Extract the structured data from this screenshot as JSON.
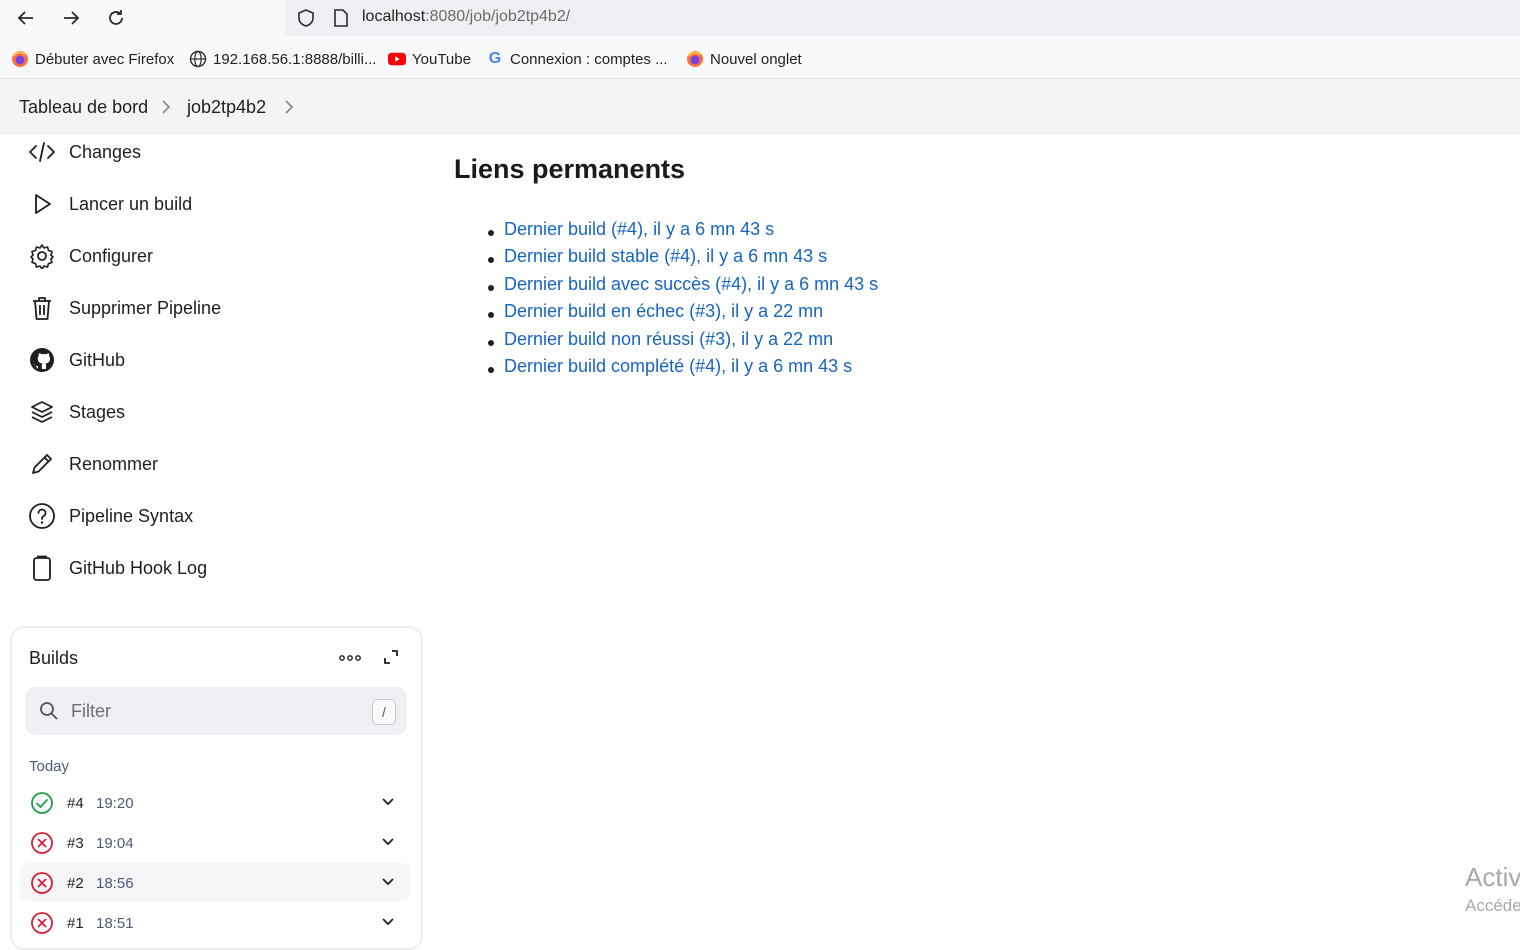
{
  "browser": {
    "url_host": "localhost",
    "url_rest": ":8080/job/job2tp4b2/",
    "bookmarks": [
      {
        "label": "Débuter avec Firefox",
        "icon": "firefox-icon"
      },
      {
        "label": "192.168.56.1:8888/billi...",
        "icon": "globe-icon"
      },
      {
        "label": "YouTube",
        "icon": "youtube-icon"
      },
      {
        "label": "Connexion : comptes ...",
        "icon": "google-icon"
      },
      {
        "label": "Nouvel onglet",
        "icon": "firefox-icon"
      }
    ]
  },
  "breadcrumb": {
    "items": [
      "Tableau de bord",
      "job2tp4b2"
    ]
  },
  "sidebar": {
    "items": [
      {
        "label": "Changes",
        "icon": "code-icon"
      },
      {
        "label": "Lancer un build",
        "icon": "play-icon"
      },
      {
        "label": "Configurer",
        "icon": "gear-icon"
      },
      {
        "label": "Supprimer Pipeline",
        "icon": "trash-icon"
      },
      {
        "label": "GitHub",
        "icon": "github-icon"
      },
      {
        "label": "Stages",
        "icon": "layers-icon"
      },
      {
        "label": "Renommer",
        "icon": "pencil-icon"
      },
      {
        "label": "Pipeline Syntax",
        "icon": "help-icon"
      },
      {
        "label": "GitHub Hook Log",
        "icon": "clipboard-icon"
      }
    ]
  },
  "builds": {
    "title": "Builds",
    "filter_placeholder": "Filter",
    "shortcut": "/",
    "group_label": "Today",
    "rows": [
      {
        "number": "#4",
        "time": "19:20",
        "status": "success"
      },
      {
        "number": "#3",
        "time": "19:04",
        "status": "failed"
      },
      {
        "number": "#2",
        "time": "18:56",
        "status": "failed"
      },
      {
        "number": "#1",
        "time": "18:51",
        "status": "failed"
      }
    ]
  },
  "main": {
    "title": "Liens permanents",
    "links": [
      "Dernier build (#4), il y a 6 mn 43 s",
      "Dernier build stable (#4), il y a 6 mn 43 s",
      "Dernier build avec succès (#4), il y a 6 mn 43 s",
      "Dernier build en échec (#3), il y a 22 mn",
      "Dernier build non réussi (#3), il y a 22 mn",
      "Dernier build complété (#4), il y a 6 mn 43 s"
    ]
  },
  "watermark": {
    "line1": "Activ",
    "line2": "Accéde"
  },
  "colors": {
    "link": "#1565c0",
    "success": "#1e9e4a",
    "failed": "#d32034"
  }
}
